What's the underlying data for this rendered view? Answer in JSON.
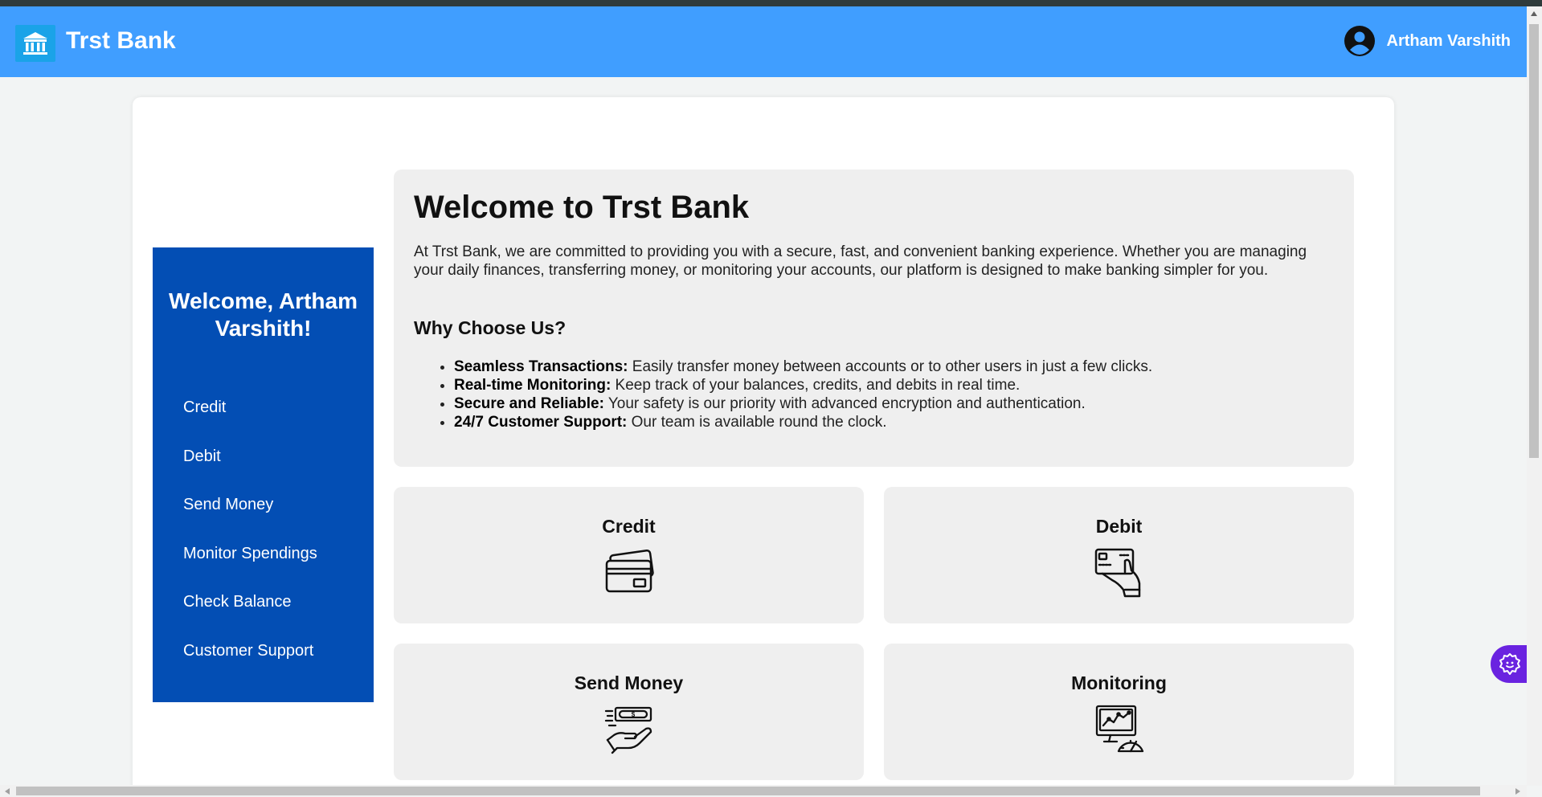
{
  "header": {
    "brand": "Trst Bank",
    "user_name": "Artham Varshith"
  },
  "sidebar": {
    "greeting": "Welcome, Artham Varshith!",
    "items": [
      {
        "label": "Credit"
      },
      {
        "label": "Debit"
      },
      {
        "label": "Send Money"
      },
      {
        "label": "Monitor Spendings"
      },
      {
        "label": "Check Balance"
      },
      {
        "label": "Customer Support"
      }
    ]
  },
  "main": {
    "title": "Welcome to Trst Bank",
    "intro": "At Trst Bank, we are committed to providing you with a secure, fast, and convenient banking experience. Whether you are managing your daily finances, transferring money, or monitoring your accounts, our platform is designed to make banking simpler for you.",
    "why_title": "Why Choose Us?",
    "features": [
      {
        "label": "Seamless Transactions:",
        "text": " Easily transfer money between accounts or to other users in just a few clicks."
      },
      {
        "label": "Real-time Monitoring:",
        "text": " Keep track of your balances, credits, and debits in real time."
      },
      {
        "label": "Secure and Reliable:",
        "text": " Your safety is our priority with advanced encryption and authentication."
      },
      {
        "label": "24/7 Customer Support:",
        "text": " Our team is available round the clock."
      }
    ],
    "tiles": [
      {
        "title": "Credit",
        "icon": "credit-cards-icon"
      },
      {
        "title": "Debit",
        "icon": "card-in-hand-icon"
      },
      {
        "title": "Send Money",
        "icon": "money-hand-icon"
      },
      {
        "title": "Monitoring",
        "icon": "monitor-gauge-icon"
      }
    ]
  },
  "colors": {
    "navbar": "#409eff",
    "sidebar": "#034eb4",
    "card": "#efefef",
    "fab": "#6a23e0"
  }
}
